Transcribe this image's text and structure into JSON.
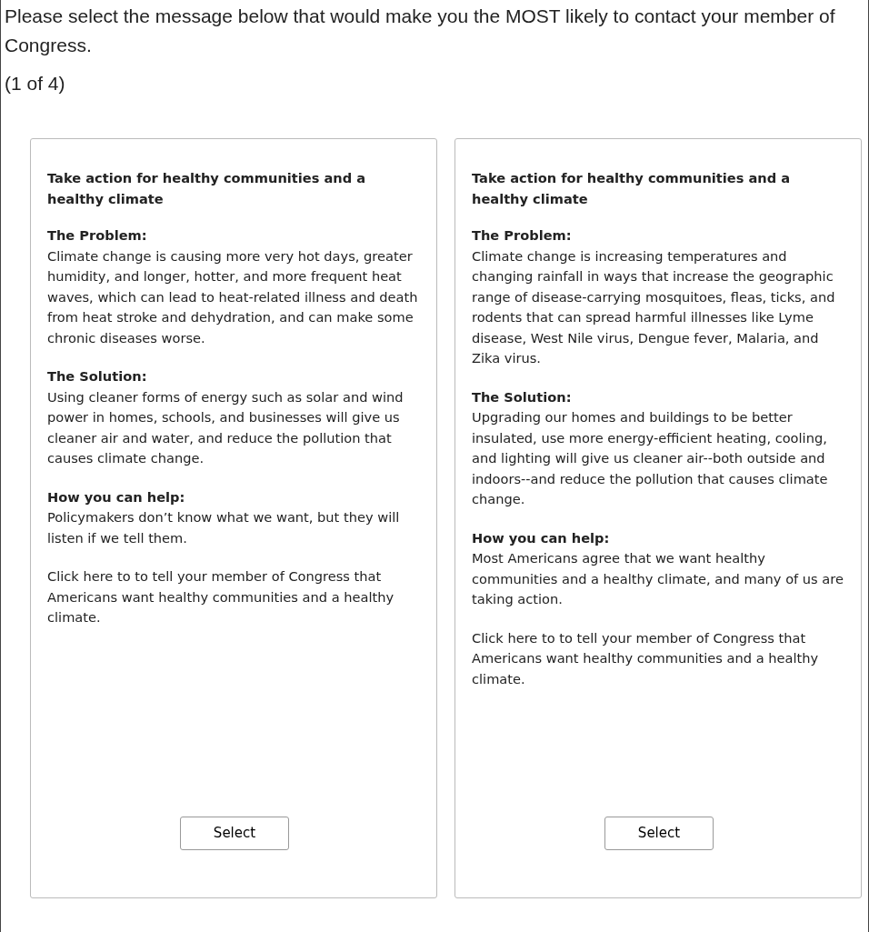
{
  "question": "Please select the message below that would make you the MOST likely to contact your member of Congress.",
  "counter": "(1 of 4)",
  "cards": [
    {
      "title": "Take action for healthy communities and a healthy climate",
      "sections": [
        {
          "heading": "The Problem:",
          "body": "Climate change is causing more very hot days, greater humidity, and longer, hotter, and more frequent heat waves, which can lead to heat-related illness and death from heat stroke and dehydration, and can make some chronic diseases worse."
        },
        {
          "heading": "The Solution:",
          "body": "Using cleaner forms of energy such as solar and wind power in homes, schools, and businesses will give us cleaner air and water, and reduce the pollution that causes climate change."
        },
        {
          "heading": "How you can help:",
          "body": "Policymakers don’t know what we want, but they will listen if we tell them."
        }
      ],
      "call_to_action": "Click here to to tell your member of Congress that Americans want healthy communities and a healthy climate.",
      "button": "Select"
    },
    {
      "title": "Take action for healthy communities and a healthy climate",
      "sections": [
        {
          "heading": "The Problem:",
          "body": "Climate change is increasing temperatures and changing rainfall in ways that increase the geographic range of disease-carrying mosquitoes, fleas, ticks, and rodents that can spread harmful illnesses like Lyme disease, West Nile virus, Dengue fever, Malaria, and Zika virus."
        },
        {
          "heading": "The Solution:",
          "body": "Upgrading our homes and buildings to be better insulated, use more energy-efficient heating, cooling, and lighting will give us cleaner air--both outside and indoors--and reduce the pollution that causes climate change."
        },
        {
          "heading": "How you can help:",
          "body": "Most Americans agree that we want healthy communities and a healthy climate, and many of us are taking action."
        }
      ],
      "call_to_action": "Click here to to tell your member of Congress that Americans want healthy communities and a healthy climate.",
      "button": "Select"
    }
  ]
}
